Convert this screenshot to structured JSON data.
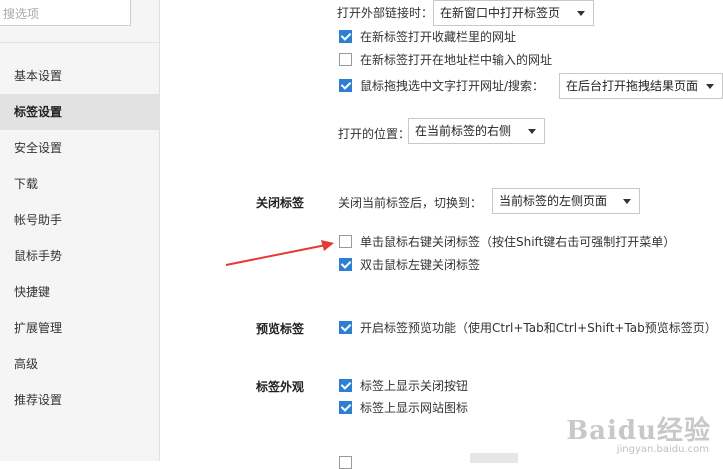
{
  "sidebar": {
    "search_placeholder": "搜选项",
    "items": [
      {
        "label": "基本设置"
      },
      {
        "label": "标签设置"
      },
      {
        "label": "安全设置"
      },
      {
        "label": "下载"
      },
      {
        "label": "帐号助手"
      },
      {
        "label": "鼠标手势"
      },
      {
        "label": "快捷键"
      },
      {
        "label": "扩展管理"
      },
      {
        "label": "高级"
      },
      {
        "label": "推荐设置"
      }
    ],
    "active_index": 1
  },
  "open_tab": {
    "external_link_label": "打开外部链接时：",
    "external_link_value": "在新窗口中打开标签页",
    "options": [
      {
        "label": "在新标签打开收藏栏里的网址",
        "checked": true
      },
      {
        "label": "在新标签打开在地址栏中输入的网址",
        "checked": false
      },
      {
        "label": "鼠标拖拽选中文字打开网址/搜索：",
        "checked": true
      }
    ],
    "drag_select_value": "在后台打开拖拽结果页面",
    "position_label": "打开的位置：",
    "position_value": "在当前标签的右侧"
  },
  "close_tab": {
    "title": "关闭标签",
    "after_close_label": "关闭当前标签后，切换到：",
    "after_close_value": "当前标签的左侧页面",
    "options": [
      {
        "label": "单击鼠标右键关闭标签（按住Shift键右击可强制打开菜单）",
        "checked": false
      },
      {
        "label": "双击鼠标左键关闭标签",
        "checked": true
      }
    ]
  },
  "preview_tab": {
    "title": "预览标签",
    "option_label": "开启标签预览功能（使用Ctrl+Tab和Ctrl+Shift+Tab预览标签页）",
    "checked": true
  },
  "tab_appearance": {
    "title": "标签外观",
    "options": [
      {
        "label": "标签上显示关闭按钮",
        "checked": true
      },
      {
        "label": "标签上显示网站图标",
        "checked": true
      }
    ]
  },
  "watermark": {
    "text": "Baidu经验",
    "sub": "jingyan.baidu.com"
  },
  "colors": {
    "accent": "#2d7fd3",
    "annotation_arrow": "#e53935",
    "sidebar_bg": "#f5f5f5",
    "active_item_bg": "#e2e2e2"
  }
}
